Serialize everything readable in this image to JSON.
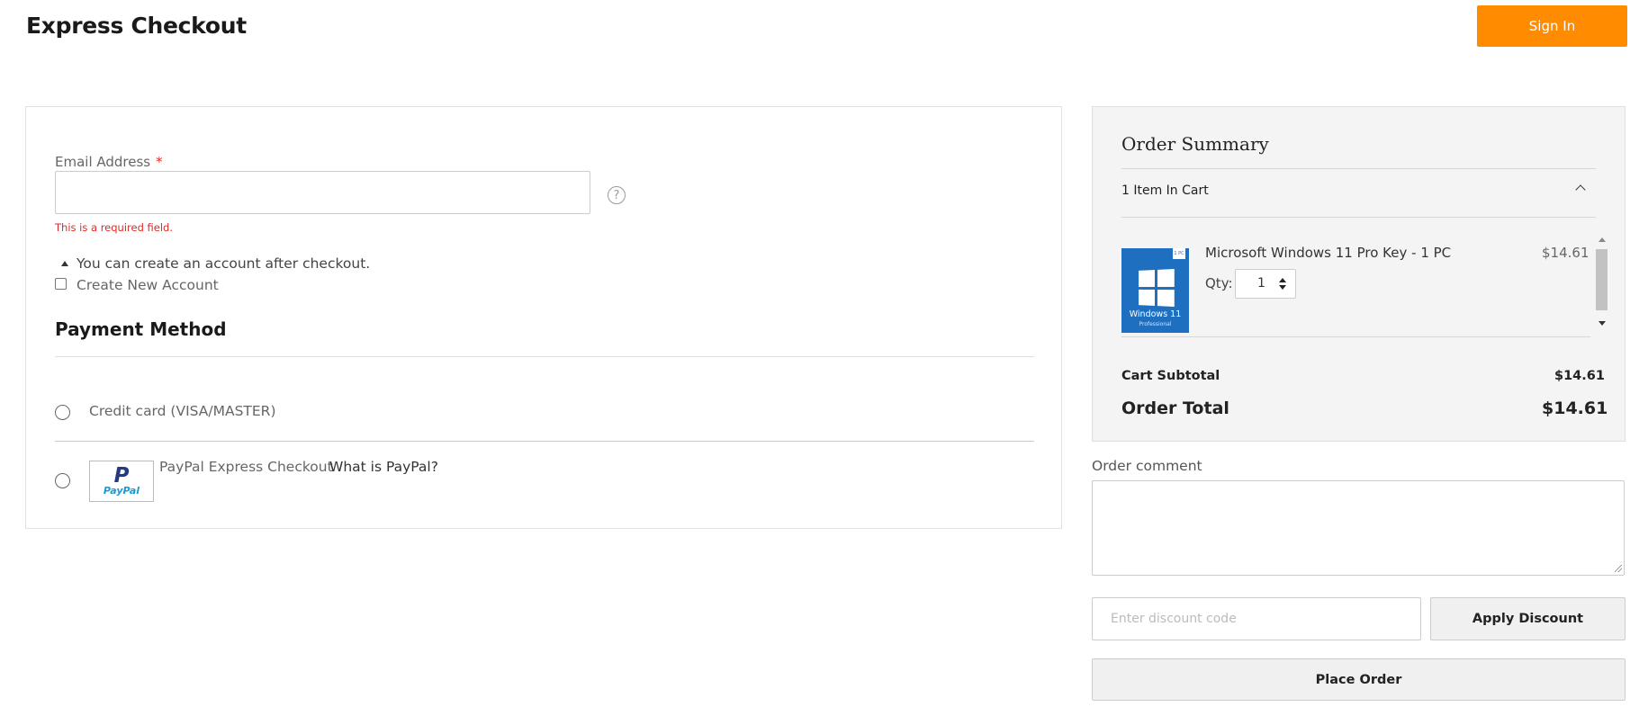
{
  "header": {
    "title": "Express Checkout",
    "sign_in_label": "Sign In"
  },
  "form": {
    "email_label": "Email Address",
    "email_required_mark": "*",
    "email_value": "",
    "email_error": "This is a required field.",
    "account_info": "You can create an account after checkout.",
    "create_account_label": "Create New Account",
    "create_account_checked": false
  },
  "payment": {
    "title": "Payment Method",
    "options": [
      {
        "label": "Credit card (VISA/MASTER)",
        "selected": false
      },
      {
        "label": "PayPal Express Checkout",
        "link": "What is PayPal?",
        "selected": false
      }
    ],
    "paypal_logo_text": "PayPal"
  },
  "summary": {
    "title": "Order Summary",
    "items_in_cart": "1 Item In Cart",
    "items": [
      {
        "name": "Microsoft Windows 11 Pro Key - 1 PC",
        "price": "$14.61",
        "qty_label": "Qty:",
        "qty": "1",
        "image_text": "Windows 11",
        "image_subtext": "Professional",
        "image_tag": "1 PC"
      }
    ],
    "subtotal_label": "Cart Subtotal",
    "subtotal_value": "$14.61",
    "total_label": "Order Total",
    "total_value": "$14.61"
  },
  "comment": {
    "label": "Order comment",
    "value": ""
  },
  "discount": {
    "placeholder": "Enter discount code",
    "apply_label": "Apply Discount"
  },
  "place_order_label": "Place Order",
  "colors": {
    "accent": "#ff8c00",
    "error": "#e02b27",
    "summary_bg": "#f4f4f4"
  }
}
